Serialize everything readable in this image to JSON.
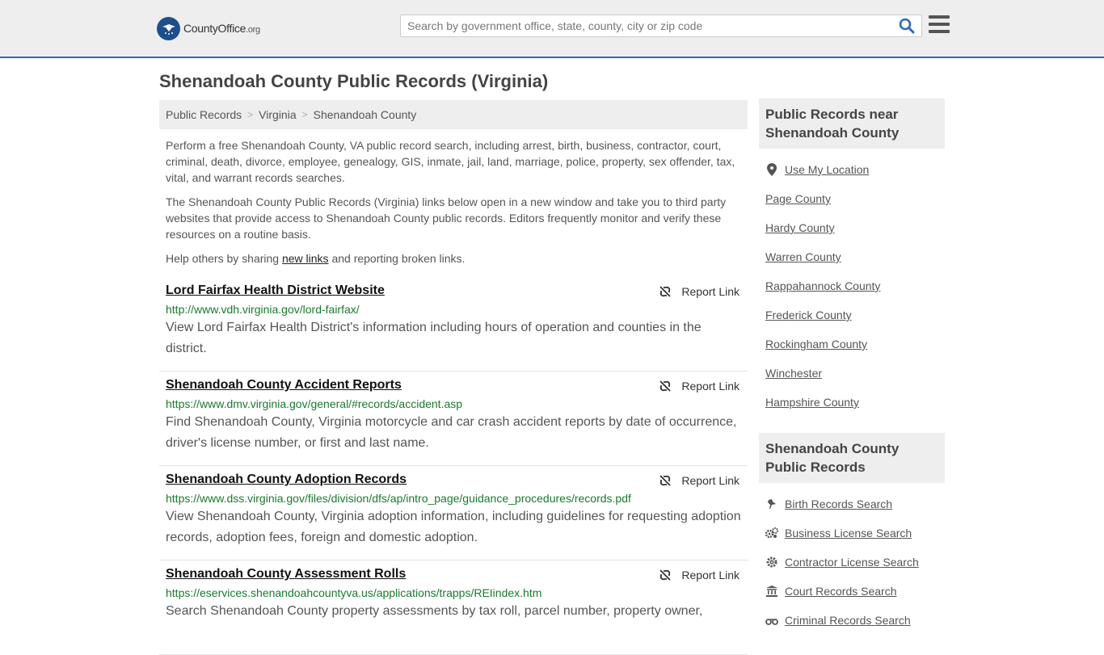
{
  "header": {
    "logo_main": "CountyOffice",
    "logo_tld": ".org",
    "search_placeholder": "Search by government office, state, county, city or zip code"
  },
  "page_title": "Shenandoah County Public Records (Virginia)",
  "breadcrumb": [
    "Public Records",
    "Virginia",
    "Shenandoah County"
  ],
  "breadcrumb_sep": ">",
  "intro": {
    "p1": "Perform a free Shenandoah County, VA public record search, including arrest, birth, business, contractor, court, criminal, death, divorce, employee, genealogy, GIS, inmate, jail, land, marriage, police, property, sex offender, tax, vital, and warrant records searches.",
    "p2": "The Shenandoah County Public Records (Virginia) links below open in a new window and take you to third party websites that provide access to Shenandoah County public records. Editors frequently monitor and verify these resources on a routine basis.",
    "p3_before": "Help others by sharing ",
    "p3_link": "new links",
    "p3_after": " and reporting broken links."
  },
  "report_label": "Report Link",
  "records": [
    {
      "title": "Lord Fairfax Health District Website",
      "url": "http://www.vdh.virginia.gov/lord-fairfax/",
      "desc": "View Lord Fairfax Health District's information including hours of operation and counties in the district."
    },
    {
      "title": "Shenandoah County Accident Reports",
      "url": "https://www.dmv.virginia.gov/general/#records/accident.asp",
      "desc": "Find Shenandoah County, Virginia motorcycle and car crash accident reports by date of occurrence, driver's license number, or first and last name."
    },
    {
      "title": "Shenandoah County Adoption Records",
      "url": "https://www.dss.virginia.gov/files/division/dfs/ap/intro_page/guidance_procedures/records.pdf",
      "desc": "View Shenandoah County, Virginia adoption information, including guidelines for requesting adoption records, adoption fees, foreign and domestic adoption."
    },
    {
      "title": "Shenandoah County Assessment Rolls",
      "url": "https://eservices.shenandoahcountyva.us/applications/trapps/REIindex.htm",
      "desc": "Search Shenandoah County property assessments by tax roll, parcel number, property owner,"
    }
  ],
  "sidebar": {
    "near_title": "Public Records near Shenandoah County",
    "near_items": [
      {
        "label": "Use My Location",
        "icon": "map-marker-icon"
      },
      {
        "label": "Page County"
      },
      {
        "label": "Hardy County"
      },
      {
        "label": "Warren County"
      },
      {
        "label": "Rappahannock County"
      },
      {
        "label": "Frederick County"
      },
      {
        "label": "Rockingham County"
      },
      {
        "label": "Winchester"
      },
      {
        "label": "Hampshire County"
      }
    ],
    "records_title": "Shenandoah County Public Records",
    "records_items": [
      {
        "label": "Birth Records Search",
        "icon": "stork-icon"
      },
      {
        "label": "Business License Search",
        "icon": "gears-icon"
      },
      {
        "label": "Contractor License Search",
        "icon": "gear-icon"
      },
      {
        "label": "Court Records Search",
        "icon": "courthouse-icon"
      },
      {
        "label": "Criminal Records Search",
        "icon": "handcuffs-icon"
      }
    ]
  },
  "colors": {
    "accent": "#2f6bb3",
    "url_green": "#1a7a2e",
    "panel_gray": "#eeeeee"
  }
}
